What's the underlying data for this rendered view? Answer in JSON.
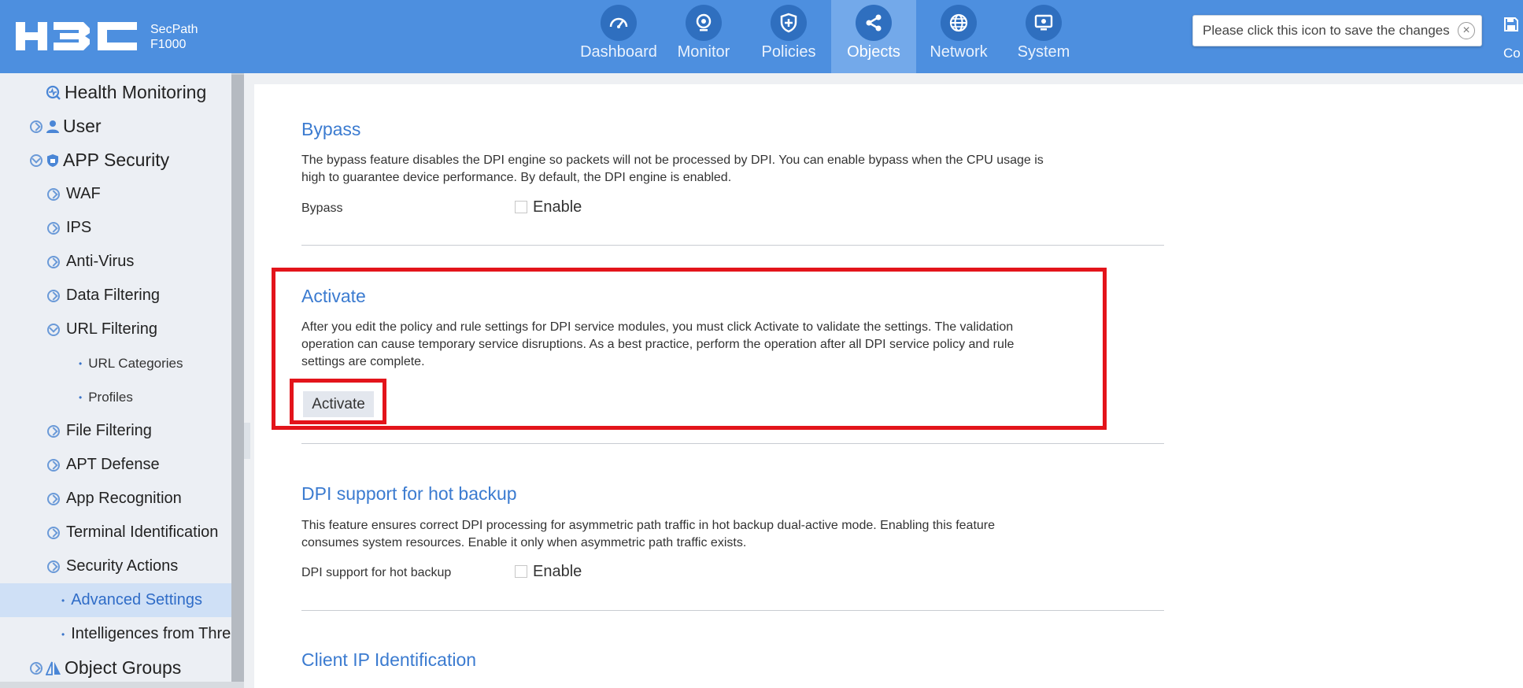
{
  "header": {
    "product_line1": "SecPath",
    "product_line2": "F1000",
    "nav": [
      {
        "label": "Dashboard",
        "icon": "dashboard-icon",
        "active": false
      },
      {
        "label": "Monitor",
        "icon": "monitor-icon",
        "active": false
      },
      {
        "label": "Policies",
        "icon": "shield-icon",
        "active": false
      },
      {
        "label": "Objects",
        "icon": "share-icon",
        "active": true
      },
      {
        "label": "Network",
        "icon": "globe-icon",
        "active": false
      },
      {
        "label": "System",
        "icon": "system-icon",
        "active": false
      }
    ],
    "tooltip_text": "Please click this icon to save the changes",
    "tooltip_close": "×",
    "save_label": "Co"
  },
  "sidebar": {
    "items": [
      {
        "label": "Health Monitoring"
      },
      {
        "label": "User"
      },
      {
        "label": "APP Security"
      },
      {
        "label": "WAF"
      },
      {
        "label": "IPS"
      },
      {
        "label": "Anti-Virus"
      },
      {
        "label": "Data Filtering"
      },
      {
        "label": "URL Filtering"
      },
      {
        "label": "URL Categories"
      },
      {
        "label": "Profiles"
      },
      {
        "label": "File Filtering"
      },
      {
        "label": "APT Defense"
      },
      {
        "label": "App Recognition"
      },
      {
        "label": "Terminal Identification"
      },
      {
        "label": "Security Actions"
      },
      {
        "label": "Advanced Settings"
      },
      {
        "label": "Intelligences from Thre"
      },
      {
        "label": "Object Groups"
      }
    ]
  },
  "main": {
    "bypass": {
      "title": "Bypass",
      "desc_line1": "The bypass feature disables the DPI engine so packets will not be processed by DPI. You can enable bypass when the CPU usage is",
      "desc_line2": "high to guarantee device performance. By default, the DPI engine is enabled.",
      "field_label": "Bypass",
      "checkbox_label": "Enable"
    },
    "activate": {
      "title": "Activate",
      "desc_line1": "After you edit the policy and rule settings for DPI service modules, you must click Activate to validate the settings. The validation",
      "desc_line2": "operation can cause temporary service disruptions. As a best practice, perform the operation after all DPI service policy and rule",
      "desc_line3": "settings are complete.",
      "button_label": "Activate"
    },
    "hot_backup": {
      "title": "DPI support for hot backup",
      "desc_line1": "This feature ensures correct DPI processing for asymmetric path traffic in hot backup dual-active mode. Enabling this feature",
      "desc_line2": "consumes system resources. Enable it only when asymmetric path traffic exists.",
      "field_label": "DPI support for hot backup",
      "checkbox_label": "Enable"
    },
    "client_ip": {
      "title": "Client IP Identification"
    }
  },
  "colors": {
    "header_bg": "#4d8fdf",
    "active_tab": "#73a9ea",
    "accent_text": "#3b7bd0",
    "highlight": "#e3141b"
  }
}
